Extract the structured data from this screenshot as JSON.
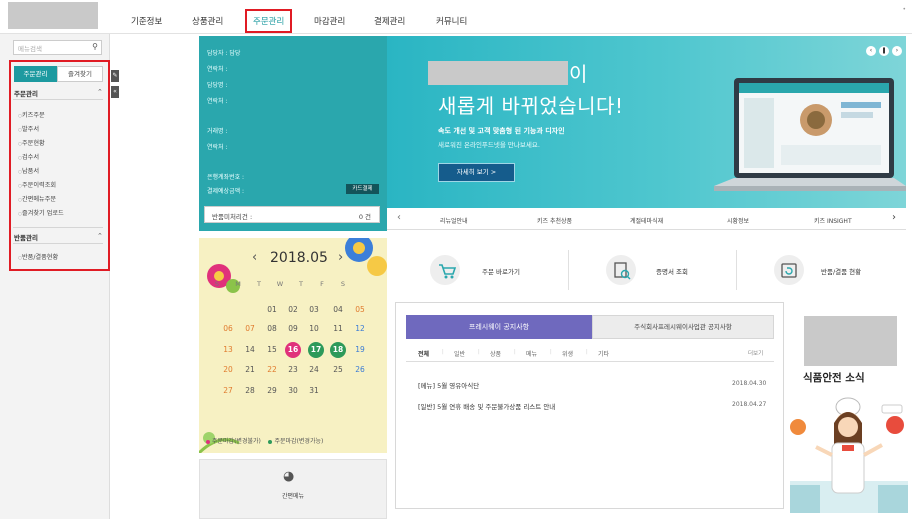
{
  "top_nav": {
    "items": [
      "기준정보",
      "상품관리",
      "주문관리",
      "마감관리",
      "결제관리",
      "커뮤니티"
    ],
    "active": "주문관리"
  },
  "sidebar": {
    "search_placeholder": "메뉴검색",
    "tabs": [
      "주문관리",
      "즐겨찾기"
    ],
    "sections": [
      {
        "title": "주문관리",
        "items": [
          "키즈주문",
          "발주서",
          "주문현황",
          "검수서",
          "납품서",
          "주문이력조회",
          "간편메뉴주문",
          "즐겨찾기 업로드"
        ]
      },
      {
        "title": "반품관리",
        "items": [
          "반품/결품현황"
        ]
      }
    ]
  },
  "info_panel": {
    "manager_label": "담당자 : 담당",
    "rows": [
      "연락처 :",
      "담당명 :",
      "연락처 :",
      "거래명 :",
      "연락처 :",
      "은행계좌번호 :",
      "결제예상금액 :"
    ],
    "card_button": "카드결제",
    "return_label": "반품미처리건 :",
    "return_count": "0 건"
  },
  "banner": {
    "line1_tail": "이",
    "line2": "새롭게 바뀌었습니다!",
    "sub1": "속도 개선 및 고객 맞춤형 된 기능과 디자인",
    "sub2": "새로워진 온라인푸드넷을 만나보세요.",
    "button": "자세히 보기  >",
    "menu": [
      "리뉴얼안내",
      "키즈 추천상품",
      "계절테마식재",
      "시황정보",
      "키즈 INSIGHT"
    ]
  },
  "quick_links": [
    "주문 바로가기",
    "증명서 조회",
    "반품/결품 현황"
  ],
  "calendar": {
    "month": "2018.05",
    "dow": [
      "S",
      "M",
      "T",
      "W",
      "T",
      "F",
      "S"
    ],
    "weeks": [
      [
        "",
        "",
        "01",
        "02",
        "03",
        "04",
        "05"
      ],
      [
        "06",
        "07",
        "08",
        "09",
        "10",
        "11",
        "12"
      ],
      [
        "13",
        "14",
        "15",
        "16",
        "17",
        "18",
        "19"
      ],
      [
        "20",
        "21",
        "22",
        "23",
        "24",
        "25",
        "26"
      ],
      [
        "27",
        "28",
        "29",
        "30",
        "31",
        "",
        ""
      ]
    ],
    "legend": [
      "주문마감(변경불가)",
      "주문마감(변경가능)"
    ],
    "legend_colors": [
      "#e0317b",
      "#2d9a5a"
    ]
  },
  "simple_menu": {
    "label": "간편메뉴"
  },
  "notice": {
    "tabs": [
      "프레시웨이 공지사항",
      "주식회사프레시웨이사업관 공지사항"
    ],
    "categories": [
      "전체",
      "일반",
      "상품",
      "메뉴",
      "위생",
      "기타"
    ],
    "more": "더보기",
    "items": [
      {
        "title": "[메뉴] 5월 영유아식단",
        "date": "2018.04.30"
      },
      {
        "title": "[일반] 5월 연휴 배송 및 주문불가상품 리스트 안내",
        "date": "2018.04.27"
      }
    ]
  },
  "food_safety": {
    "title": "식품안전 소식"
  },
  "colors": {
    "teal": "#2aa7ad",
    "red_highlight": "#e01b24",
    "notice_purple": "#6f69be",
    "calendar_bg": "#f7f1c3"
  }
}
